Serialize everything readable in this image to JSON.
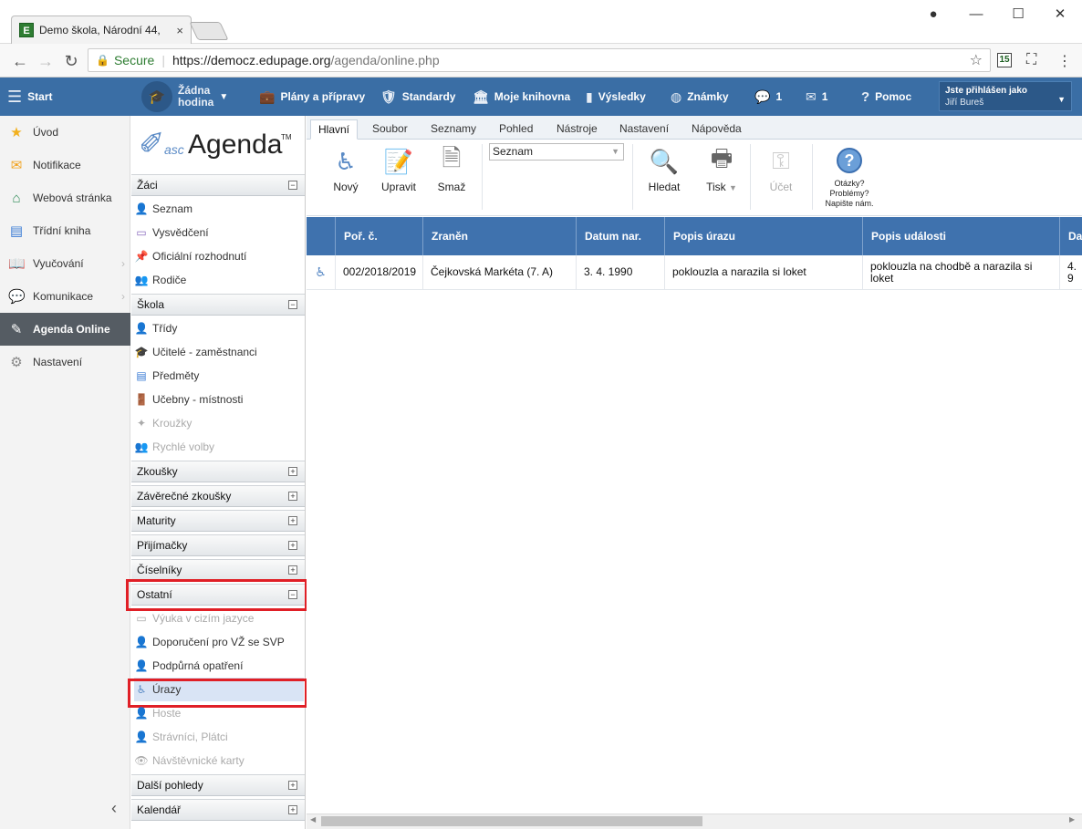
{
  "browser": {
    "tab_title": "Demo škola, Národní 44,",
    "tab_close": "×",
    "secure_label": "Secure",
    "url_base": "https://democz.edupage.org",
    "url_path": "/agenda/online.php",
    "ext_badge": "15"
  },
  "topbar": {
    "start": "Start",
    "hodina_line1": "Žádna",
    "hodina_line2": "hodina",
    "plany": "Plány a přípravy",
    "standardy": "Standardy",
    "knihovna": "Moje knihovna",
    "vysledky": "Výsledky",
    "znamky": "Známky",
    "messages_count": "1",
    "mail_count": "1",
    "pomoc": "Pomoc",
    "user_label": "Jste přihlášen jako",
    "user_name": "Jiří Bureš"
  },
  "leftnav": {
    "items": [
      {
        "label": "Úvod",
        "icon": "star-icon"
      },
      {
        "label": "Notifikace",
        "icon": "envelope-icon"
      },
      {
        "label": "Webová stránka",
        "icon": "home-icon"
      },
      {
        "label": "Třídní kniha",
        "icon": "book-icon"
      },
      {
        "label": "Vyučování",
        "icon": "open-book-icon"
      },
      {
        "label": "Komunikace",
        "icon": "chat-icon"
      },
      {
        "label": "Agenda Online",
        "icon": "pen-icon"
      },
      {
        "label": "Nastavení",
        "icon": "gear-icon"
      }
    ]
  },
  "logo": {
    "asc": "asc",
    "agenda": "Agenda",
    "tm": "TM"
  },
  "sidebar": {
    "zaci": {
      "title": "Žáci",
      "items": [
        "Seznam",
        "Vysvědčení",
        "Oficiální rozhodnutí",
        "Rodiče"
      ]
    },
    "skola": {
      "title": "Škola",
      "items": [
        "Třídy",
        "Učitelé - zaměstnanci",
        "Předměty",
        "Učebny - místnosti",
        "Kroužky",
        "Rychlé volby"
      ]
    },
    "zkousky": "Zkoušky",
    "zaverecne": "Závěrečné zkoušky",
    "maturity": "Maturity",
    "prijimacky": "Přijímačky",
    "ciselniky": "Číselníky",
    "ostatni": {
      "title": "Ostatní",
      "items": [
        "Výuka v cizím jazyce",
        "Doporučení pro VŽ se SVP",
        "Podpůrná opatření",
        "Úrazy",
        "Hoste",
        "Strávníci, Plátci",
        "Návštěvnické karty"
      ]
    },
    "dalsi": "Další pohledy",
    "kalendar": "Kalendář"
  },
  "ribbon": {
    "tabs": [
      "Hlavní",
      "Soubor",
      "Seznamy",
      "Pohled",
      "Nástroje",
      "Nastavení",
      "Nápověda"
    ],
    "novy": "Nový",
    "upravit": "Upravit",
    "smaz": "Smaž",
    "seznam_select": "Seznam",
    "hledat": "Hledat",
    "tisk": "Tisk",
    "ucet": "Účet",
    "help_line1": "Otázky?",
    "help_line2": "Problémy?",
    "help_line3": "Napište nám."
  },
  "table": {
    "columns": [
      "Poř. č.",
      "Zraněn",
      "Datum nar.",
      "Popis úrazu",
      "Popis události",
      "Da"
    ],
    "rows": [
      {
        "por": "002/2018/2019",
        "zranen": "Čejkovská Markéta (7. A)",
        "datum": "3. 4. 1990",
        "popis_urazu": "poklouzla a narazila si loket",
        "popis_udalosti": "poklouzla na chodbě a narazila si loket",
        "da": "4. 9"
      }
    ]
  }
}
